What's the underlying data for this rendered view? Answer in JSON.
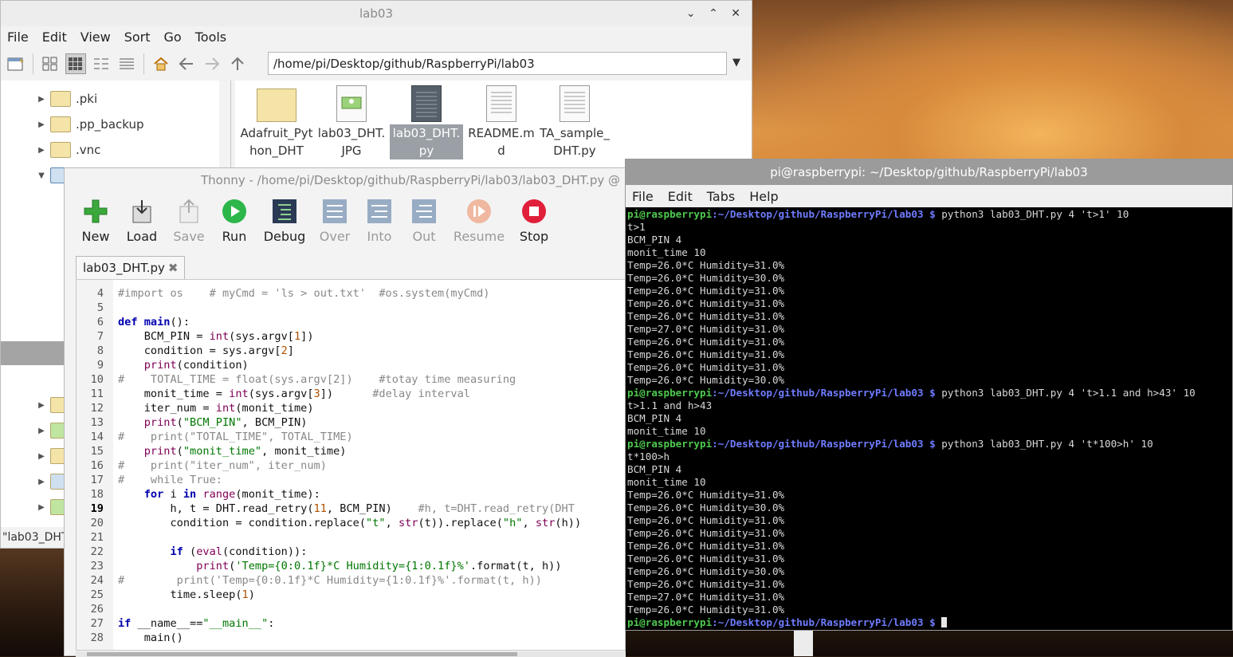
{
  "file_manager": {
    "title": "lab03",
    "window_buttons": [
      "⌄",
      "⌃",
      "✕"
    ],
    "menu": [
      "File",
      "Edit",
      "View",
      "Sort",
      "Go",
      "Tools"
    ],
    "path": "/home/pi/Desktop/github/RaspberryPi/lab03",
    "tree": [
      ".pki",
      ".pp_backup",
      ".vnc"
    ],
    "files": [
      {
        "name": "Adafruit_Pyt\nhon_DHT",
        "type": "folder"
      },
      {
        "name": "lab03_DHT.\nJPG",
        "type": "image"
      },
      {
        "name": "lab03_DHT.\npy",
        "type": "python",
        "selected": true
      },
      {
        "name": "README.m\nd",
        "type": "text"
      },
      {
        "name": "TA_sample_\nDHT.py",
        "type": "text"
      }
    ],
    "status": "\"lab03_DHT"
  },
  "thonny": {
    "title": "Thonny  -  /home/pi/Desktop/github/RaspberryPi/lab03/lab03_DHT.py  @",
    "toolbar": {
      "new": "New",
      "load": "Load",
      "save": "Save",
      "run": "Run",
      "debug": "Debug",
      "over": "Over",
      "into": "Into",
      "out": "Out",
      "resume": "Resume",
      "stop": "Stop"
    },
    "tab_label": "lab03_DHT.py",
    "code_lines": [
      {
        "n": "4",
        "t": "#import os    # myCmd = 'ls > out.txt'  #os.system(myCmd)"
      },
      {
        "n": "5",
        "t": ""
      },
      {
        "n": "6",
        "t": "def main():"
      },
      {
        "n": "7",
        "t": "    BCM_PIN = int(sys.argv[1])"
      },
      {
        "n": "8",
        "t": "    condition = sys.argv[2]"
      },
      {
        "n": "9",
        "t": "    print(condition)"
      },
      {
        "n": "10",
        "t": "#    TOTAL_TIME = float(sys.argv[2])    #totay time measuring"
      },
      {
        "n": "11",
        "t": "    monit_time = int(sys.argv[3])      #delay interval"
      },
      {
        "n": "12",
        "t": "    iter_num = int(monit_time)"
      },
      {
        "n": "13",
        "t": "    print(\"BCM_PIN\", BCM_PIN)"
      },
      {
        "n": "14",
        "t": "#    print(\"TOTAL_TIME\", TOTAL_TIME)"
      },
      {
        "n": "15",
        "t": "    print(\"monit_time\", monit_time)"
      },
      {
        "n": "16",
        "t": "#    print(\"iter_num\", iter_num)"
      },
      {
        "n": "17",
        "t": "#    while True:"
      },
      {
        "n": "18",
        "t": "    for i in range(monit_time):"
      },
      {
        "n": "19",
        "t": "        h, t = DHT.read_retry(11, BCM_PIN)    #h, t=DHT.read_retry(DHT"
      },
      {
        "n": "20",
        "t": "        condition = condition.replace(\"t\", str(t)).replace(\"h\", str(h))"
      },
      {
        "n": "21",
        "t": ""
      },
      {
        "n": "22",
        "t": "        if (eval(condition)):"
      },
      {
        "n": "23",
        "t": "            print('Temp={0:0.1f}*C Humidity={1:0.1f}%'.format(t, h))"
      },
      {
        "n": "24",
        "t": "#        print('Temp={0:0.1f}*C Humidity={1:0.1f}%'.format(t, h))"
      },
      {
        "n": "25",
        "t": "        time.sleep(1)"
      },
      {
        "n": "26",
        "t": ""
      },
      {
        "n": "27",
        "t": "if __name__==\"__main__\":"
      },
      {
        "n": "28",
        "t": "    main()"
      }
    ]
  },
  "terminal": {
    "title": "pi@raspberrypi: ~/Desktop/github/RaspberryPi/lab03",
    "menu": [
      "File",
      "Edit",
      "Tabs",
      "Help"
    ],
    "prompt_user": "pi@raspberrypi",
    "prompt_path": ":~/Desktop/github/RaspberryPi/lab03 $",
    "lines": [
      {
        "prompt": true,
        "cmd": " python3 lab03_DHT.py 4 't>1' 10"
      },
      {
        "text": "t>1"
      },
      {
        "text": "BCM_PIN 4"
      },
      {
        "text": "monit_time 10"
      },
      {
        "text": "Temp=26.0*C Humidity=31.0%"
      },
      {
        "text": "Temp=26.0*C Humidity=30.0%"
      },
      {
        "text": "Temp=26.0*C Humidity=31.0%"
      },
      {
        "text": "Temp=26.0*C Humidity=31.0%"
      },
      {
        "text": "Temp=26.0*C Humidity=31.0%"
      },
      {
        "text": "Temp=27.0*C Humidity=31.0%"
      },
      {
        "text": "Temp=26.0*C Humidity=31.0%"
      },
      {
        "text": "Temp=26.0*C Humidity=31.0%"
      },
      {
        "text": "Temp=26.0*C Humidity=31.0%"
      },
      {
        "text": "Temp=26.0*C Humidity=30.0%"
      },
      {
        "prompt": true,
        "cmd": " python3 lab03_DHT.py 4 't>1.1 and h>43' 10"
      },
      {
        "text": "t>1.1 and h>43"
      },
      {
        "text": "BCM_PIN 4"
      },
      {
        "text": "monit_time 10"
      },
      {
        "prompt": true,
        "cmd": " python3 lab03_DHT.py 4 't*100>h' 10"
      },
      {
        "text": "t*100>h"
      },
      {
        "text": "BCM_PIN 4"
      },
      {
        "text": "monit_time 10"
      },
      {
        "text": "Temp=26.0*C Humidity=31.0%"
      },
      {
        "text": "Temp=26.0*C Humidity=30.0%"
      },
      {
        "text": "Temp=26.0*C Humidity=31.0%"
      },
      {
        "text": "Temp=26.0*C Humidity=31.0%"
      },
      {
        "text": "Temp=26.0*C Humidity=31.0%"
      },
      {
        "text": "Temp=26.0*C Humidity=31.0%"
      },
      {
        "text": "Temp=26.0*C Humidity=30.0%"
      },
      {
        "text": "Temp=26.0*C Humidity=31.0%"
      },
      {
        "text": "Temp=27.0*C Humidity=31.0%"
      },
      {
        "text": "Temp=26.0*C Humidity=31.0%"
      },
      {
        "prompt": true,
        "cmd": " ",
        "cursor": true
      }
    ]
  }
}
